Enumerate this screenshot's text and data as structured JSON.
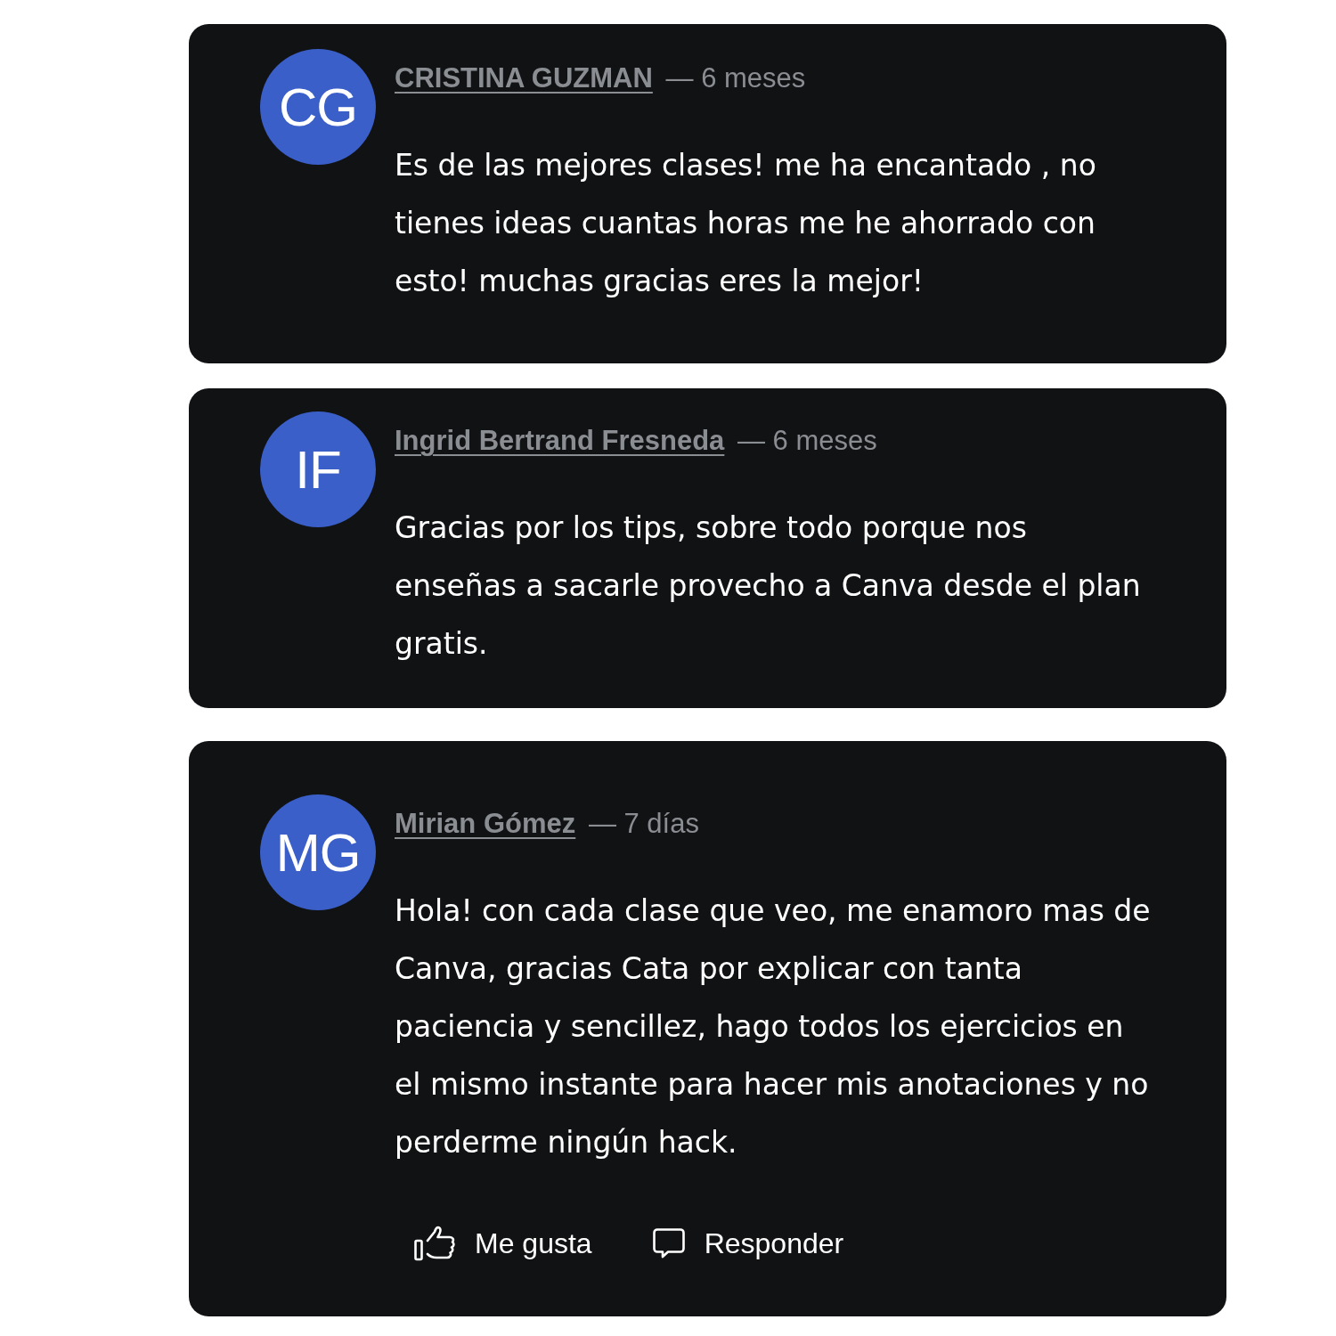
{
  "comments": [
    {
      "avatar": {
        "initials": "CG"
      },
      "author": "CRISTINA GUZMAN",
      "time": "— 6 meses",
      "text": "Es de las mejores clases! me ha encantado , no tienes ideas cuantas horas me he ahorrado con esto! muchas gracias eres la mejor!"
    },
    {
      "avatar": {
        "initials": "IF"
      },
      "author": "Ingrid Bertrand Fresneda",
      "time": "— 6 meses",
      "text": "Gracias por los tips, sobre todo porque nos enseñas a sacarle provecho a Canva desde el plan gratis."
    },
    {
      "avatar": {
        "initials": "MG"
      },
      "author": "Mirian Gómez",
      "time": "— 7 días",
      "text": "Hola! con cada clase que veo, me enamoro mas de Canva, gracias Cata por explicar con tanta paciencia y sencillez, hago todos los ejercicios en el mismo instante para hacer mis anotaciones y no perderme ningún hack.",
      "actions": [
        {
          "kind": "like",
          "label": "Me gusta"
        },
        {
          "kind": "reply",
          "label": "Responder"
        }
      ]
    }
  ]
}
